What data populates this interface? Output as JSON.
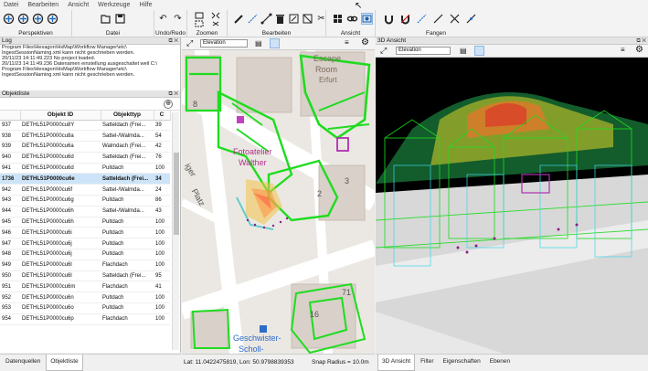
{
  "menu": [
    "Datei",
    "Bearbeiten",
    "Ansicht",
    "Werkzeuge",
    "Hilfe"
  ],
  "toolbar": {
    "groups": [
      {
        "label": "Perspektiven",
        "icons": [
          "perspective-icon",
          "perspective-icon",
          "perspective-icon",
          "perspective-icon"
        ]
      },
      {
        "label": "Datei",
        "icons": [
          "open-file-icon",
          "save-icon"
        ]
      },
      {
        "label": "Undo/Redo",
        "icons": [
          "undo-icon",
          "redo-icon"
        ]
      },
      {
        "label": "Zoomen",
        "icons": [
          "zoom-extent-icon",
          "zoom-fit-icon",
          "zoom-selection-icon",
          "zoom-reset-icon"
        ]
      },
      {
        "label": "Bearbeiten",
        "icons": [
          "pen-icon",
          "line-icon",
          "move-icon",
          "delete-icon",
          "edit-icon",
          "split-icon",
          "scissors-icon"
        ]
      },
      {
        "label": "Ansicht",
        "icons": [
          "grid-view-icon",
          "link-icon",
          "camera-icon"
        ]
      },
      {
        "label": "Fangen",
        "icons": [
          "snap-magnet-icon",
          "snap-magnet-off-icon",
          "snap-line-icon",
          "snap-line-icon",
          "snap-cross-icon",
          "snap-segment-icon"
        ]
      }
    ]
  },
  "log": {
    "title": "Log",
    "lines": [
      "Program Files\\Hexagon\\HxMap\\Workflow Manager\\etc\\",
      "IngestSessionNaming.xml kann nicht geschrieben werden.",
      "20/11/23 14:11:49.223 No project loaded.",
      "20/11/23 14:11:49.236 Datenamen einstellung ausgeschaltet weil C:\\",
      "Program Files\\Hexagon\\HxMap\\Workflow Manager\\etc\\",
      "IngestSessionNaming.xml kann nicht geschrieben werden."
    ]
  },
  "objektliste": {
    "title": "Objektliste",
    "columns": [
      "",
      "Objekt ID",
      "Objekttyp",
      "C"
    ],
    "rows": [
      [
        "937",
        "DETHL51P0000cu8Y",
        "Satteldach (Frei...",
        "39"
      ],
      [
        "938",
        "DETHL51P0000cu8a",
        "Sattel-/Walmda...",
        "54"
      ],
      [
        "939",
        "DETHL51P0000cu6a",
        "Walmdach (Frei...",
        "42"
      ],
      [
        "940",
        "DETHL51P0000cu6d",
        "Satteldach (Frei...",
        "76"
      ],
      [
        "941",
        "DETHL51P0000cu6d",
        "Pultdach",
        "100"
      ],
      [
        "1736",
        "DETHL51P0000cu6e",
        "Satteldach (Frei...",
        "34"
      ],
      [
        "942",
        "DETHL51P0000cu6f",
        "Sattel-/Walmda...",
        "24"
      ],
      [
        "943",
        "DETHL51P0000cu6g",
        "Pultdach",
        "86"
      ],
      [
        "944",
        "DETHL51P0000cu6h",
        "Sattel-/Walmda...",
        "43"
      ],
      [
        "945",
        "DETHL51P0000cu6h",
        "Pultdach",
        "100"
      ],
      [
        "946",
        "DETHL51P0000cu6i",
        "Pultdach",
        "100"
      ],
      [
        "947",
        "DETHL51P0000cu6j",
        "Pultdach",
        "100"
      ],
      [
        "948",
        "DETHL51P0000cu6j",
        "Pultdach",
        "100"
      ],
      [
        "949",
        "DETHL51P0000cu6l",
        "Flachdach",
        "100"
      ],
      [
        "950",
        "DETHL51P0000cu6l",
        "Satteldach (Frei...",
        "95"
      ],
      [
        "951",
        "DETHL51P0000cu6m",
        "Flachdach",
        "41"
      ],
      [
        "952",
        "DETHL51P0000cu6n",
        "Pultdach",
        "100"
      ],
      [
        "953",
        "DETHL51P0000cu6o",
        "Pultdach",
        "100"
      ],
      [
        "954",
        "DETHL51P0000cu6p",
        "Flachdach",
        "100"
      ]
    ],
    "selected_row": 5
  },
  "left_tabs": [
    "Datenquellen",
    "Objektliste"
  ],
  "left_active_tab": 1,
  "map": {
    "dropdown": "Elevation",
    "labels": {
      "escape": "Escape",
      "room": "Room",
      "erfurt": "Erfurt",
      "fotoatelier1": "Fotoatelier",
      "fotoatelier2": "Walther",
      "platz": "Platz",
      "platz_prefix": "iger",
      "n2": "2",
      "n3": "3",
      "n8": "8",
      "n71": "71",
      "n16": "16",
      "geschwister1": "Geschwister-",
      "geschwister2": "Scholl-"
    }
  },
  "view3d": {
    "title": "3D Ansicht",
    "dropdown": "Elevation"
  },
  "status": {
    "coords": "Lat: 11.0422475819, Lon: 50.9798839353",
    "snap": "Snap Radius = 10.0m"
  },
  "right_tabs": [
    "3D Ansicht",
    "Filter",
    "Eigenschaften",
    "Ebenen"
  ],
  "right_active_tab": 0
}
